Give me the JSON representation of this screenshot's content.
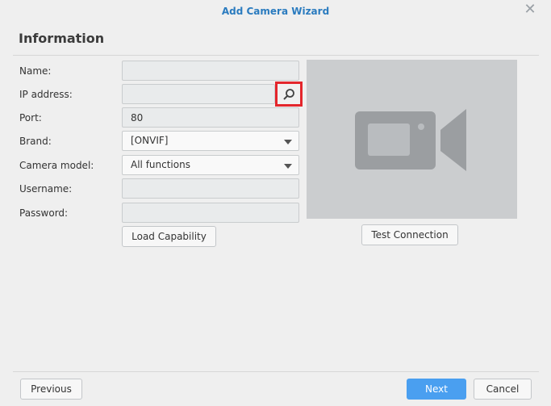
{
  "window": {
    "title": "Add Camera Wizard",
    "close_icon": "close-icon"
  },
  "section": {
    "heading": "Information"
  },
  "form": {
    "name": {
      "label": "Name:",
      "value": ""
    },
    "ip_address": {
      "label": "IP address:",
      "value": ""
    },
    "port": {
      "label": "Port:",
      "value": "80"
    },
    "brand": {
      "label": "Brand:",
      "value": "[ONVIF]"
    },
    "camera_model": {
      "label": "Camera model:",
      "value": "All functions"
    },
    "username": {
      "label": "Username:",
      "value": ""
    },
    "password": {
      "label": "Password:",
      "value": ""
    }
  },
  "buttons": {
    "load_capability": "Load Capability",
    "test_connection": "Test Connection",
    "previous": "Previous",
    "next": "Next",
    "cancel": "Cancel"
  },
  "colors": {
    "accent": "#2a7bbf",
    "primary_button": "#4a9ff0",
    "highlight": "#e4262c",
    "preview_bg": "#cbcdcf"
  }
}
